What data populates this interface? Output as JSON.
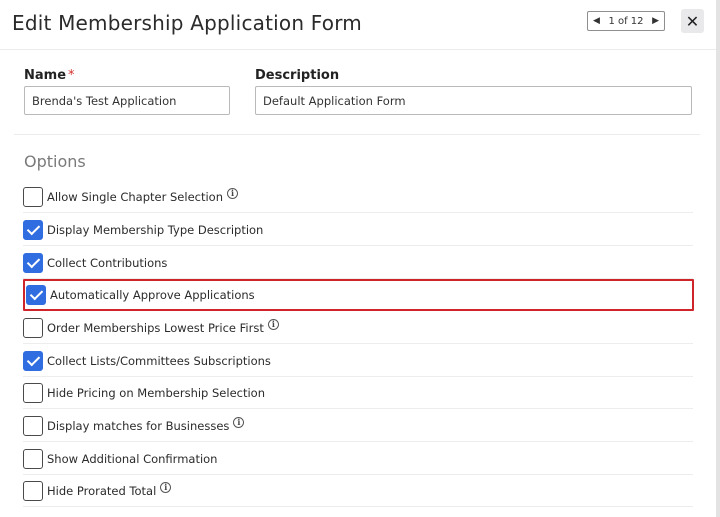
{
  "header": {
    "title": "Edit Membership Application Form",
    "pager_text": "1 of 12",
    "pager_prev_icon": "chevron-left-icon",
    "pager_next_icon": "chevron-right-icon",
    "close_symbol": "✕"
  },
  "form": {
    "name_label": "Name",
    "name_required_mark": "*",
    "name_value": "Brenda's Test Application",
    "description_label": "Description",
    "description_value": "Default Application Form"
  },
  "options": {
    "heading": "Options",
    "items": [
      {
        "label": "Allow Single Chapter Selection",
        "checked": false,
        "info": true
      },
      {
        "label": "Display Membership Type Description",
        "checked": true,
        "info": false
      },
      {
        "label": "Collect Contributions",
        "checked": true,
        "info": false
      },
      {
        "label": "Automatically Approve Applications",
        "checked": true,
        "info": false,
        "highlighted": true
      },
      {
        "label": "Order Memberships Lowest Price First",
        "checked": false,
        "info": true
      },
      {
        "label": "Collect Lists/Committees Subscriptions",
        "checked": true,
        "info": false
      },
      {
        "label": "Hide Pricing on Membership Selection",
        "checked": false,
        "info": false
      },
      {
        "label": "Display matches for Businesses",
        "checked": false,
        "info": true
      },
      {
        "label": "Show Additional Confirmation",
        "checked": false,
        "info": false
      },
      {
        "label": "Hide Prorated Total",
        "checked": false,
        "info": true
      }
    ]
  },
  "colors": {
    "checkbox_checked": "#2f6de1",
    "highlight_border": "#d0242b",
    "required_mark": "#d0312d"
  }
}
